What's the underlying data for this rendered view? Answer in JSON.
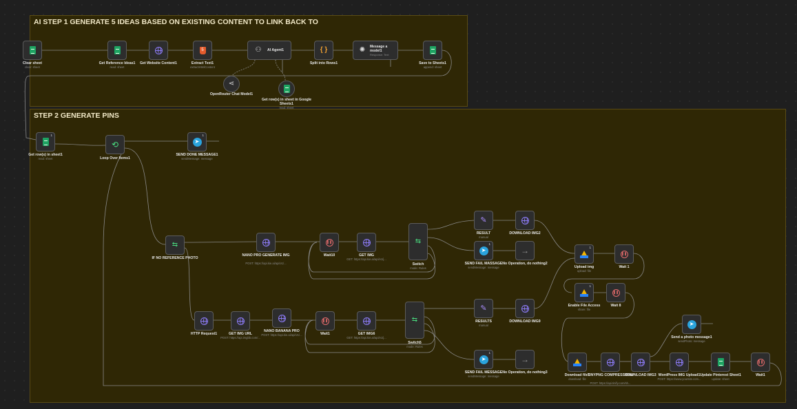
{
  "colors": {
    "canvas": "#1f1f1f",
    "sticky": "#2f2705",
    "node": "#2d2d2d",
    "connection": "#8a8a8a"
  },
  "stickies": [
    {
      "title": "AI STEP 1 GENERATE 5 IDEAS BASED ON EXISTING CONTENT TO LINK BACK TO"
    },
    {
      "title": "STEP 2 GENERATE PINS"
    }
  ],
  "nodes": {
    "clear_sheet": {
      "label": "Clear sheet",
      "sub": "clear: sheet",
      "icon": "sheets-icon"
    },
    "get_reference_ideas": {
      "label": "Get Reference Ideas1",
      "sub": "read: sheet",
      "icon": "sheets-icon"
    },
    "get_website_content": {
      "label": "Get Website Content1",
      "sub": "",
      "icon": "globe-icon"
    },
    "extract_text": {
      "label": "Extract Text1",
      "sub": "extractHtmlContent",
      "icon": "html-icon",
      "glyph": "5"
    },
    "ai_agent": {
      "label": "AI Agent1",
      "sub": "",
      "icon": "robot-icon",
      "glyph": "⚇"
    },
    "split_into_rows": {
      "label": "Split into Rows1",
      "sub": "",
      "icon": "code-icon",
      "glyph": "{ }"
    },
    "message_model": {
      "label": "Message a model1",
      "sub": "Response: Text",
      "icon": "openai-icon",
      "glyph": "✺"
    },
    "save_to_sheets": {
      "label": "Save to Sheets1",
      "sub": "append: sheet",
      "icon": "sheets-icon"
    },
    "openrouter_chat": {
      "label": "OpenRouter Chat Model1",
      "sub": "",
      "icon": "openrouter-icon",
      "glyph": "⋖"
    },
    "get_rows_google_sheets": {
      "label": "Get row(s) in sheet in Google Sheets1",
      "sub": "read: sheet",
      "icon": "sheets-icon"
    },
    "get_rows_sheet": {
      "label": "Get row(s) in sheet1",
      "sub": "read: sheet",
      "icon": "sheets-icon",
      "badge": "1"
    },
    "loop_over_items": {
      "label": "Loop Over Items1",
      "sub": "",
      "icon": "loop-icon",
      "glyph": "⟲"
    },
    "send_done_message": {
      "label": "SEND DONE MESSAGE1",
      "sub": "sendMessage: message",
      "icon": "telegram-icon",
      "badge": "1"
    },
    "if_no_reference": {
      "label": "IF NO REFERENCE PHOTO",
      "sub": "",
      "icon": "if-icon",
      "glyph": "⇆"
    },
    "nano_pro_generate": {
      "label": "NANO PRO GENERATE IMG",
      "sub": "POST: https://api.kie.ai/api/v1/...",
      "icon": "globe-icon"
    },
    "wait10": {
      "label": "Wait10",
      "sub": "",
      "icon": "wait-icon"
    },
    "get_img": {
      "label": "GET IMG",
      "sub": "GET: https://api.kie.ai/api/v1/j...",
      "icon": "globe-icon"
    },
    "switch": {
      "label": "Switch",
      "sub": "mode: Rules",
      "icon": "switch-icon",
      "glyph": "⇆"
    },
    "result7": {
      "label": "RESULT",
      "sub": "manual",
      "icon": "pencil-icon",
      "glyph": "✎"
    },
    "download_img2": {
      "label": "DOWNLOAD IMG2",
      "sub": "",
      "icon": "globe-icon"
    },
    "send_fail_message_1": {
      "label": "SEND FAIL MASSAGE",
      "sub": "sendMessage: message",
      "icon": "telegram-icon",
      "badge": "1"
    },
    "no_op_1": {
      "label": "No Operation, do nothing2",
      "sub": "",
      "icon": "arrow-icon",
      "glyph": "→"
    },
    "upload_img": {
      "label": "Upload img",
      "sub": "upload: file",
      "icon": "drive-icon",
      "badge": "1"
    },
    "wait1": {
      "label": "Wait 1",
      "sub": "",
      "icon": "wait-icon"
    },
    "enable_file_access": {
      "label": "Enable File Access",
      "sub": "share: file",
      "icon": "drive-icon",
      "badge": "1"
    },
    "wait8": {
      "label": "Wait 8",
      "sub": "",
      "icon": "wait-icon"
    },
    "http_request": {
      "label": "HTTP Request1",
      "sub": "",
      "icon": "globe-icon"
    },
    "get_img_url": {
      "label": "GET IMG URL",
      "sub": "POST: https://api.imgbb.com/...",
      "icon": "globe-icon"
    },
    "nano_banana_pro": {
      "label": "NANO BANANA PRO",
      "sub": "POST: https://api.kie.ai/api/v1/...",
      "icon": "globe-icon"
    },
    "wait_b": {
      "label": "Wait1",
      "sub": "",
      "icon": "wait-icon"
    },
    "get_img6": {
      "label": "GET IMG6",
      "sub": "GET: https://api.kie.ai/api/v1/j...",
      "icon": "globe-icon"
    },
    "switch5": {
      "label": "Switch5",
      "sub": "mode: Rules",
      "icon": "switch-icon",
      "glyph": "⇆"
    },
    "results5": {
      "label": "RESULTS",
      "sub": "manual",
      "icon": "pencil-icon",
      "glyph": "✎"
    },
    "download_img9": {
      "label": "DOWNLOAD IMG9",
      "sub": "",
      "icon": "globe-icon"
    },
    "send_fail_message_2": {
      "label": "SEND FAIL MESSAGE",
      "sub": "sendMessage: message",
      "icon": "telegram-icon",
      "badge": "1"
    },
    "no_op_2": {
      "label": "No Operation, do nothing3",
      "sub": "",
      "icon": "arrow-icon",
      "glyph": "→"
    },
    "send_photo_message": {
      "label": "Send a photo message1",
      "sub": "sendPhoto: message",
      "icon": "telegram-icon"
    },
    "download_file": {
      "label": "Download file1",
      "sub": "download: file",
      "icon": "drive-icon"
    },
    "tinypng": {
      "label": "TINYPNG COMPRESSION1",
      "sub": "POST: https://api.tinify.com/sh...",
      "icon": "globe-icon"
    },
    "download_img3": {
      "label": "DOWNLOAD IMG3",
      "sub": "",
      "icon": "globe-icon"
    },
    "wordpress_upload": {
      "label": "WordPress IMG Upload1",
      "sub": "POST: https://www.yoursite.com...",
      "icon": "globe-icon"
    },
    "update_pinterest_sheet": {
      "label": "Update Pinterest Sheet1",
      "sub": "update: sheet",
      "icon": "sheets-icon"
    },
    "wait_last": {
      "label": "Wait1",
      "sub": "",
      "icon": "wait-icon"
    }
  }
}
